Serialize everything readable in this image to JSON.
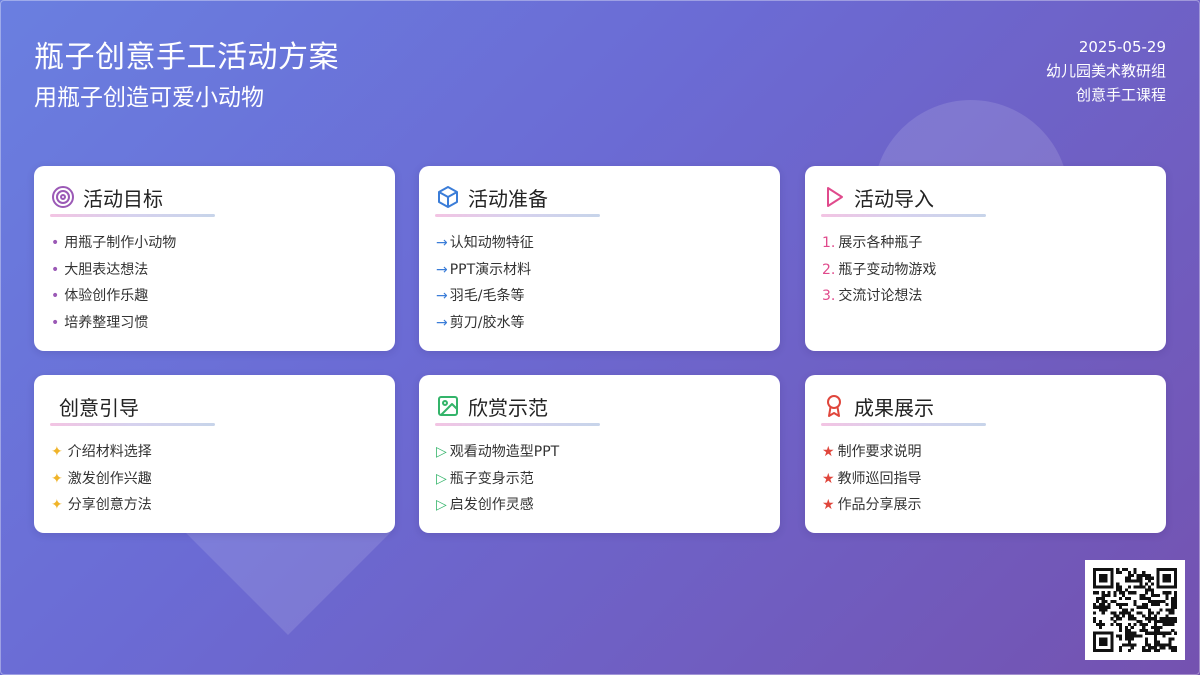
{
  "header": {
    "title": "瓶子创意手工活动方案",
    "subtitle": "用瓶子创造可爱小动物",
    "date": "2025-05-29",
    "org": "幼儿园美术教研组",
    "course": "创意手工课程"
  },
  "colors": {
    "purple": "#9b59b6",
    "blue": "#3b7dd8",
    "pink": "#e04a8c",
    "gold": "#f0b429",
    "green": "#34b46a",
    "red": "#e0463c"
  },
  "cards": [
    {
      "title": "活动目标",
      "icon": "target-icon",
      "marker": "•",
      "items": [
        "用瓶子制作小动物",
        "大胆表达想法",
        "体验创作乐趣",
        "培养整理习惯"
      ]
    },
    {
      "title": "活动准备",
      "icon": "cube-icon",
      "marker": "→",
      "items": [
        "认知动物特征",
        "PPT演示材料",
        "羽毛/毛条等",
        "剪刀/胶水等"
      ]
    },
    {
      "title": "活动导入",
      "icon": "play-icon",
      "marker": "numbered",
      "items": [
        "展示各种瓶子",
        "瓶子变动物游戏",
        "交流讨论想法"
      ],
      "numbers": [
        "1.",
        "2.",
        "3."
      ]
    },
    {
      "title": "创意引导",
      "icon": "",
      "marker": "✦",
      "items": [
        "介绍材料选择",
        "激发创作兴趣",
        "分享创意方法"
      ]
    },
    {
      "title": "欣赏示范",
      "icon": "image-icon",
      "marker": "▷",
      "items": [
        "观看动物造型PPT",
        "瓶子变身示范",
        "启发创作灵感"
      ]
    },
    {
      "title": "成果展示",
      "icon": "award-icon",
      "marker": "★",
      "items": [
        "制作要求说明",
        "教师巡回指导",
        "作品分享展示"
      ]
    }
  ]
}
